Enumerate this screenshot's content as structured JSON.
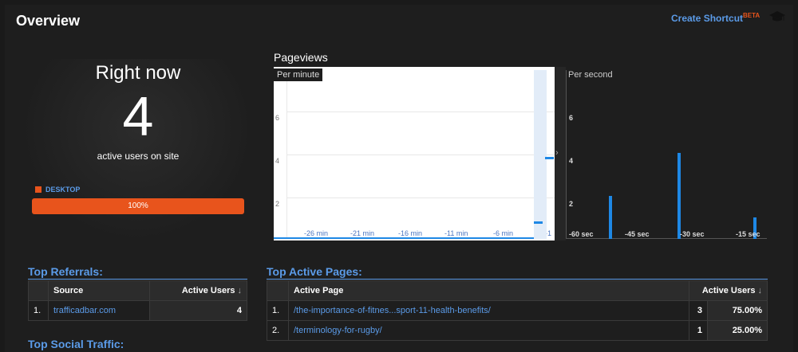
{
  "header": {
    "title": "Overview",
    "create_shortcut": "Create Shortcut",
    "beta": "BETA",
    "icon": "graduation-cap-icon"
  },
  "right_now": {
    "label": "Right now",
    "count": "4",
    "sub": "active users on site",
    "device_label": "DESKTOP",
    "device_percent": "100%",
    "device_fraction": 1.0,
    "device_color": "#e8541c"
  },
  "pageviews": {
    "title": "Pageviews",
    "per_minute": {
      "label": "Per minute",
      "y_ticks": [
        "6",
        "4",
        "2"
      ],
      "x_ticks": [
        "-26 min",
        "-21 min",
        "-16 min",
        "-11 min",
        "-6 min",
        "-1"
      ],
      "bars": [
        {
          "x": -2,
          "y": 2
        },
        {
          "x": -1,
          "y": 5
        }
      ]
    },
    "per_second": {
      "label": "Per second",
      "y_ticks": [
        "6",
        "4",
        "2"
      ],
      "x_ticks": [
        "-60 sec",
        "-45 sec",
        "-30 sec",
        "-15 sec"
      ],
      "bars": [
        {
          "x": -46,
          "y": 2
        },
        {
          "x": -26,
          "y": 4
        },
        {
          "x": -4,
          "y": 1
        }
      ]
    },
    "bar_color": "#1e88e5"
  },
  "top_referrals": {
    "heading": "Top Referrals:",
    "columns": [
      "Source",
      "Active Users"
    ],
    "rows": [
      {
        "index": "1.",
        "source": "trafficadbar.com",
        "users": "4"
      }
    ]
  },
  "top_social": {
    "heading": "Top Social Traffic:"
  },
  "top_pages": {
    "heading": "Top Active Pages:",
    "columns": [
      "Active Page",
      "Active Users"
    ],
    "rows": [
      {
        "index": "1.",
        "page": "/the-importance-of-fitnes...sport-11-health-benefits/",
        "users": "3",
        "percent": "75.00%"
      },
      {
        "index": "2.",
        "page": "/terminology-for-rugby/",
        "users": "1",
        "percent": "25.00%"
      }
    ]
  },
  "colors": {
    "accent": "#5b9be8",
    "orange": "#e8541c"
  }
}
